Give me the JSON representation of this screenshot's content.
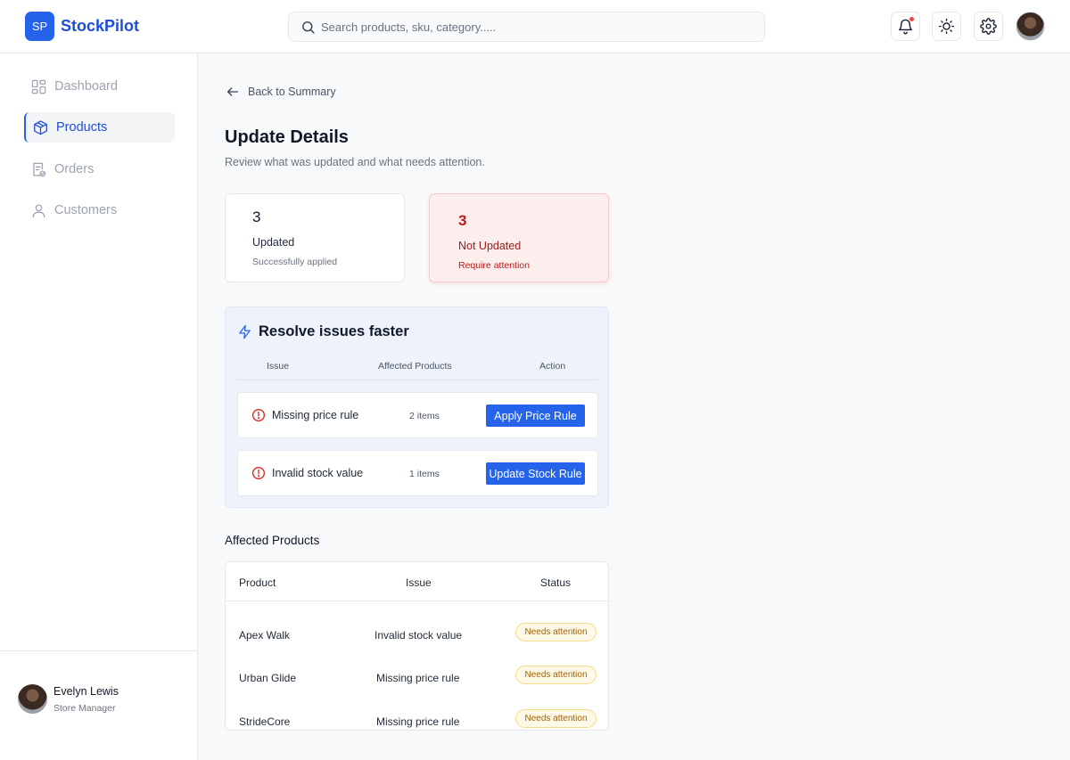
{
  "header": {
    "logo_initials": "SP",
    "brand_name": "StockPilot",
    "search_placeholder": "Search products, sku, category.....",
    "icons": [
      "bell-icon",
      "sun-icon",
      "gear-icon"
    ]
  },
  "sidebar": {
    "items": [
      {
        "label": "Dashboard",
        "icon": "dashboard-icon",
        "active": false
      },
      {
        "label": "Products",
        "icon": "box-icon",
        "active": true
      },
      {
        "label": "Orders",
        "icon": "orders-icon",
        "active": false
      },
      {
        "label": "Customers",
        "icon": "user-icon",
        "active": false
      }
    ],
    "user": {
      "name": "Evelyn Lewis",
      "role": "Store Manager"
    }
  },
  "main": {
    "back_label": "Back to Summary",
    "title": "Update Details",
    "subtitle": "Review what was updated and what needs attention.",
    "stats": {
      "updated": {
        "value": "3",
        "label": "Updated",
        "note": "Successfully applied"
      },
      "not_updated": {
        "value": "3",
        "label": "Not Updated",
        "note": "Require attention"
      }
    },
    "resolve": {
      "title": "Resolve issues faster",
      "columns": [
        "Issue",
        "Affected Products",
        "Action"
      ],
      "rows": [
        {
          "issue": "Missing price rule",
          "count": "2 items",
          "action": "Apply Price Rule"
        },
        {
          "issue": "Invalid stock value",
          "count": "1 items",
          "action": "Update Stock Rule"
        }
      ]
    },
    "affected": {
      "title": "Affected Products",
      "columns": [
        "Product",
        "Issue",
        "Status"
      ],
      "rows": [
        {
          "product": "Apex Walk",
          "issue": "Invalid stock value",
          "status": "Needs attention"
        },
        {
          "product": "Urban Glide",
          "issue": "Missing price rule",
          "status": "Needs attention"
        },
        {
          "product": "StrideCore",
          "issue": "Missing price rule",
          "status": "Needs attention"
        }
      ]
    }
  },
  "colors": {
    "accent": "#2563eb",
    "brand_text": "#1d4ed8",
    "error": "#b91c1c",
    "error_bg": "#fdeeee",
    "warning_bg": "#fef9e7",
    "warning_text": "#a16207"
  }
}
